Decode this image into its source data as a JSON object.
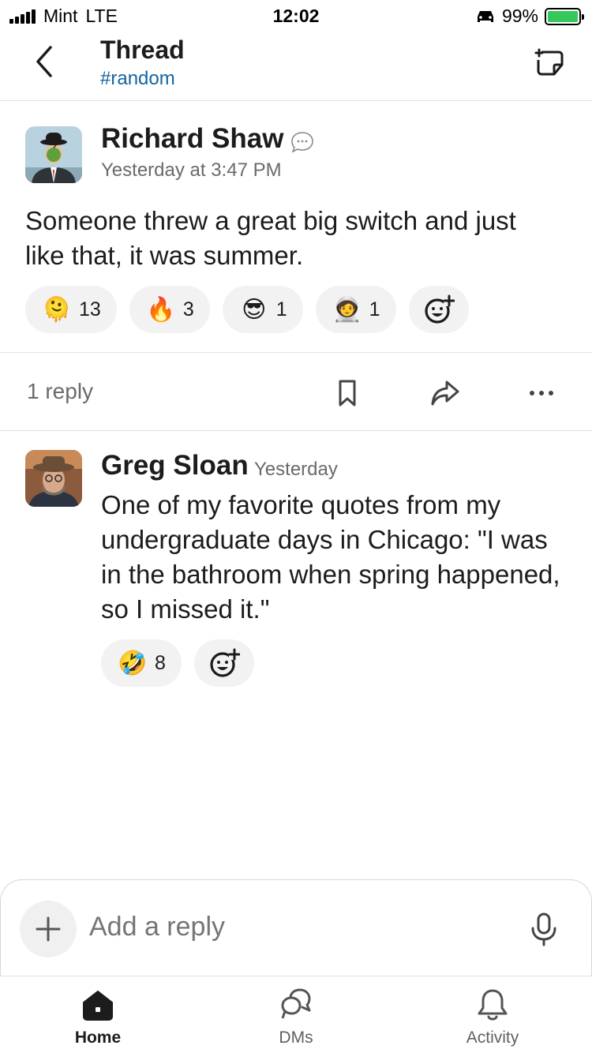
{
  "status_bar": {
    "carrier": "Mint",
    "network": "LTE",
    "time": "12:02",
    "battery": "99%"
  },
  "header": {
    "title": "Thread",
    "channel": "#random"
  },
  "parent_message": {
    "author": "Richard Shaw",
    "timestamp": "Yesterday at 3:47 PM",
    "text": "Someone threw a great big switch and just like that, it was summer.",
    "reactions": [
      {
        "emoji": "🫠",
        "count": "13"
      },
      {
        "emoji": "🔥",
        "count": "3"
      },
      {
        "emoji": "😎",
        "count": "1"
      },
      {
        "emoji": "🧑‍🚀",
        "count": "1"
      }
    ]
  },
  "thread_actions": {
    "reply_count": "1 reply"
  },
  "reply_message": {
    "author": "Greg Sloan",
    "timestamp": "Yesterday",
    "text": "One of my favorite quotes from my undergraduate days in Chicago:  \"I was in the bathroom when spring happened, so I missed it.\"",
    "reactions": [
      {
        "emoji": "🤣",
        "count": "8"
      }
    ]
  },
  "composer": {
    "placeholder": "Add a reply"
  },
  "tabbar": {
    "home": "Home",
    "dms": "DMs",
    "activity": "Activity"
  },
  "colors": {
    "link": "#1264a3",
    "battery": "#34c759",
    "pill_bg": "#f3f2f3"
  }
}
